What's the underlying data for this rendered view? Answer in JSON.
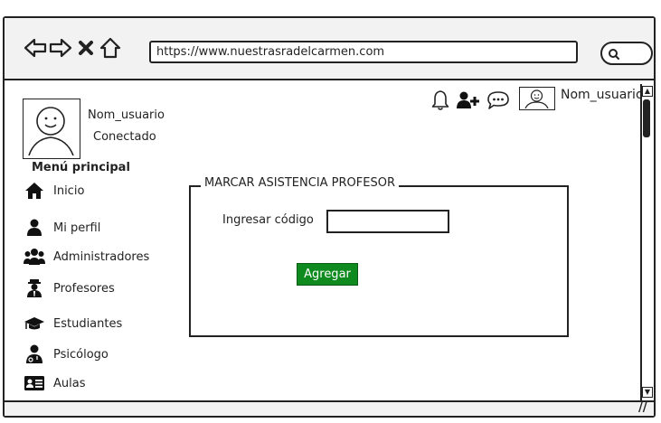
{
  "browser": {
    "url": "https://www.nuestrasradelcarmen.com",
    "nav_icons": [
      "back-arrow-icon",
      "forward-arrow-icon",
      "close-icon",
      "home-icon",
      "search-icon"
    ]
  },
  "user_card": {
    "name": "Nom_usuario",
    "status": "Conectado"
  },
  "menu": {
    "title": "Menú principal",
    "items": [
      {
        "label": "Inicio",
        "icon": "home-icon"
      },
      {
        "label": "Mi perfil",
        "icon": "user-icon"
      },
      {
        "label": "Administradores",
        "icon": "users-icon"
      },
      {
        "label": "Profesores",
        "icon": "professor-icon"
      },
      {
        "label": "Estudiantes",
        "icon": "graduation-cap-icon"
      },
      {
        "label": "Psicólogo",
        "icon": "psychologist-icon"
      },
      {
        "label": "Aulas",
        "icon": "classroom-card-icon"
      }
    ]
  },
  "header": {
    "user_name": "Nom_usuario",
    "icons": [
      "bell-icon",
      "add-user-icon",
      "chat-icon"
    ]
  },
  "form": {
    "legend": "MARCAR ASISTENCIA PROFESOR",
    "code_label": "Ingresar código",
    "code_value": "",
    "submit_label": "Agregar",
    "submit_color": "#0f8a1f"
  }
}
